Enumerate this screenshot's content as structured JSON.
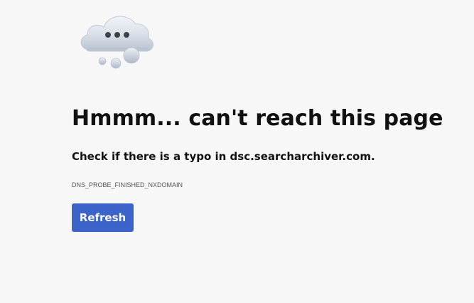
{
  "error_page": {
    "icon": "cloud-with-ellipsis-icon",
    "title": "Hmmm... can't reach this page",
    "suggestion": "Check if there is a typo in dsc.searcharchiver.com.",
    "error_code": "DNS_PROBE_FINISHED_NXDOMAIN",
    "refresh_label": "Refresh"
  },
  "colors": {
    "background": "#f7f7f7",
    "title_text": "#111111",
    "secondary_text": "#555555",
    "button": "#3b63c9",
    "button_text": "#ffffff"
  }
}
